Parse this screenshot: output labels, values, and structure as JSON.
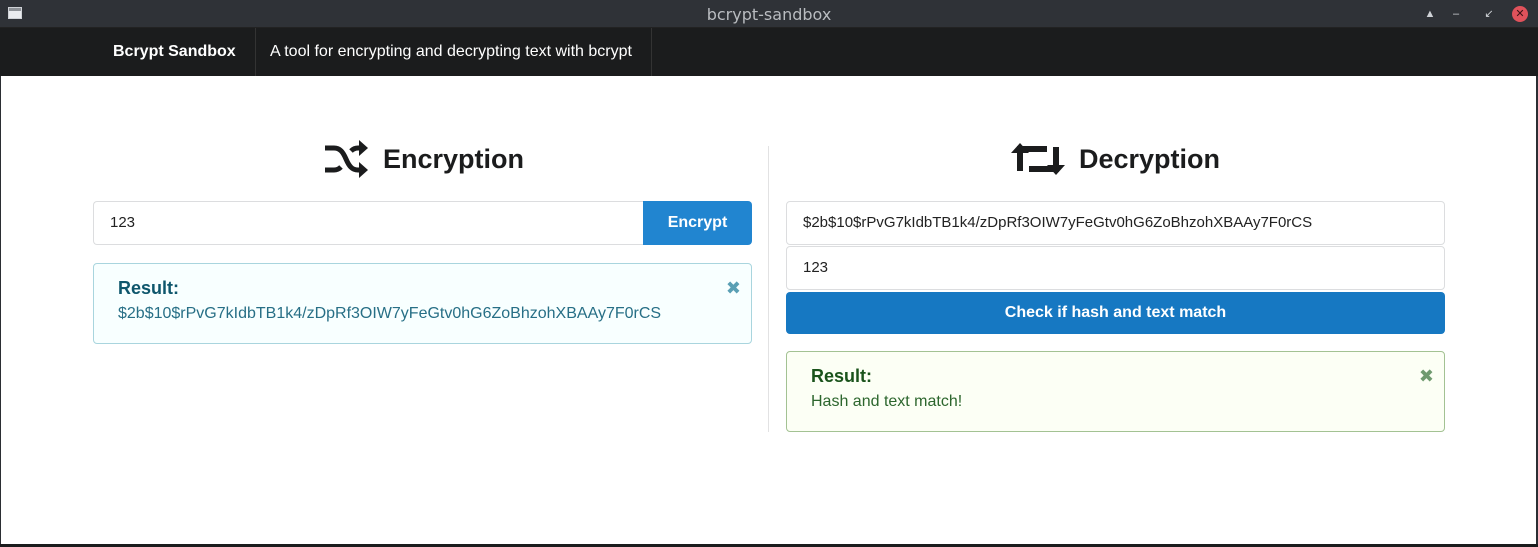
{
  "window": {
    "title": "bcrypt-sandbox",
    "controls": {
      "up": "▲",
      "minimize": "–",
      "restore": "↙",
      "close": "✕"
    }
  },
  "navbar": {
    "brand": "Bcrypt Sandbox",
    "description": "A tool for encrypting and decrypting text with bcrypt"
  },
  "encryption": {
    "heading": "Encryption",
    "icon": "shuffle-icon",
    "input_value": "123",
    "button_label": "Encrypt",
    "result": {
      "header": "Result:",
      "text": "$2b$10$rPvG7kIdbTB1k4/zDpRf3OIW7yFeGtv0hG6ZoBhzohXBAAy7F0rCS",
      "close_glyph": "✖"
    }
  },
  "decryption": {
    "heading": "Decryption",
    "icon": "retweet-icon",
    "hash_value": "$2b$10$rPvG7kIdbTB1k4/zDpRf3OIW7yFeGtv0hG6ZoBhzohXBAAy7F0rCS",
    "text_value": "123",
    "button_label": "Check if hash and text match",
    "result": {
      "header": "Result:",
      "text": "Hash and text match!",
      "close_glyph": "✖"
    }
  },
  "colors": {
    "primary_button": "#2185d0",
    "check_button": "#1678c2",
    "navbar": "#1b1c1d",
    "info_bg": "#f8ffff",
    "success_bg": "#fcfff5",
    "close_button": "#e0525b"
  }
}
